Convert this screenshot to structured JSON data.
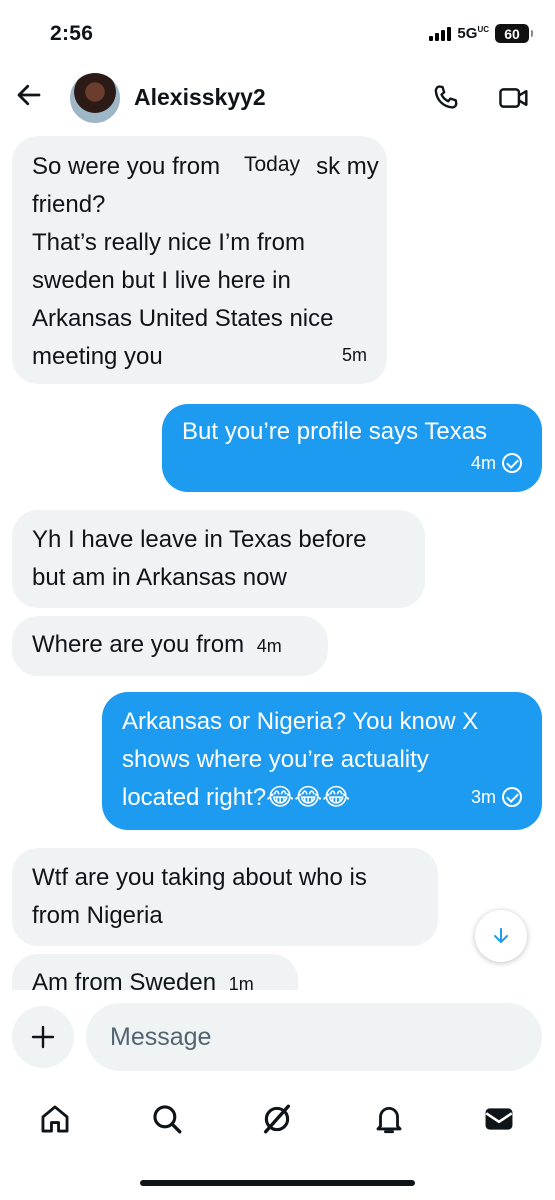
{
  "status_bar": {
    "time": "2:56",
    "network": "5G",
    "network_sup": "UC",
    "battery": "60"
  },
  "header": {
    "contact_name": "Alexisskyy2",
    "icons": {
      "back": "back-arrow-icon",
      "call": "phone-icon",
      "video": "video-camera-icon"
    }
  },
  "conversation": {
    "date_pill": "Today",
    "messages": [
      {
        "direction": "incoming",
        "lines": [
          "So were you from",
          "friend?",
          "That’s really nice I’m from",
          "sweden but I live here in",
          "Arkansas United States nice",
          "meeting you"
        ],
        "first_line_tail": "sk my",
        "time": "5m"
      },
      {
        "direction": "outgoing",
        "lines": [
          "But you’re profile says Texas"
        ],
        "time": "4m"
      },
      {
        "direction": "incoming",
        "lines": [
          "Yh I have leave in Texas before",
          "but am in Arkansas now"
        ],
        "time": ""
      },
      {
        "direction": "incoming",
        "lines": [
          "Where are you from"
        ],
        "time": "4m"
      },
      {
        "direction": "outgoing",
        "lines": [
          "Arkansas or Nigeria? You know X",
          "shows where you’re actuality",
          "located right?😂😂😂"
        ],
        "time": "3m"
      },
      {
        "direction": "incoming",
        "lines": [
          "Wtf are you taking about who is",
          "from Nigeria"
        ],
        "time": ""
      },
      {
        "direction": "incoming",
        "lines": [
          "Am from Sweden"
        ],
        "time": "1m"
      }
    ]
  },
  "composer": {
    "placeholder": "Message",
    "add_icon": "plus-icon"
  },
  "bottom_nav": {
    "items": [
      "home-icon",
      "search-icon",
      "grok-icon",
      "notifications-bell-icon",
      "messages-envelope-icon"
    ]
  },
  "colors": {
    "accent": "#1d9bf0",
    "incoming_bubble": "#eff3f4",
    "text": "#0f1419",
    "placeholder": "#536471"
  }
}
